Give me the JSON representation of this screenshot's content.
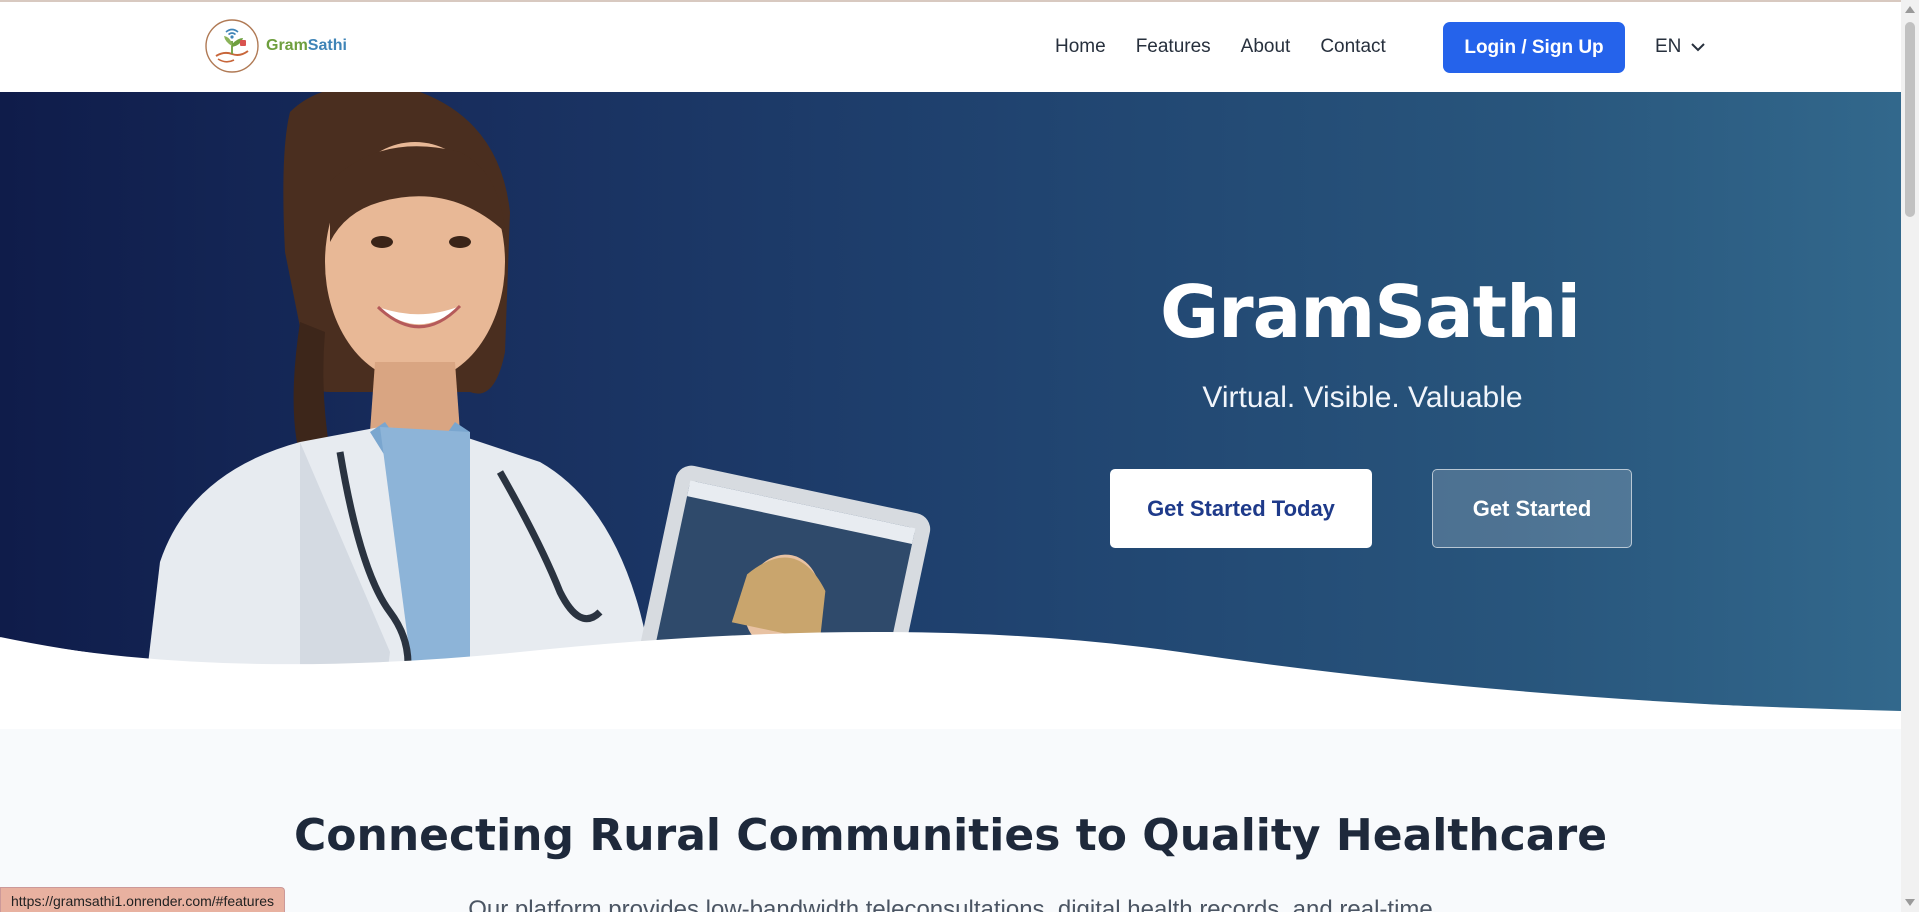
{
  "header": {
    "logo": {
      "part1": "Gram",
      "part2": "Sathi"
    },
    "nav": [
      "Home",
      "Features",
      "About",
      "Contact"
    ],
    "login_label": "Login / Sign Up",
    "language": "EN"
  },
  "hero": {
    "title": "GramSathi",
    "subtitle": "Virtual. Visible. Valuable",
    "primary_button": "Get Started Today",
    "secondary_button": "Get Started"
  },
  "section": {
    "title": "Connecting Rural Communities to Quality Healthcare",
    "description": "Our platform provides low-bandwidth teleconsultations, digital health records, and real-time"
  },
  "status_bar": {
    "url": "https://gramsathi1.onrender.com/#features"
  },
  "colors": {
    "brand_blue": "#2563eb",
    "hero_dark": "#0f1c4a",
    "hero_light": "#32688c"
  }
}
